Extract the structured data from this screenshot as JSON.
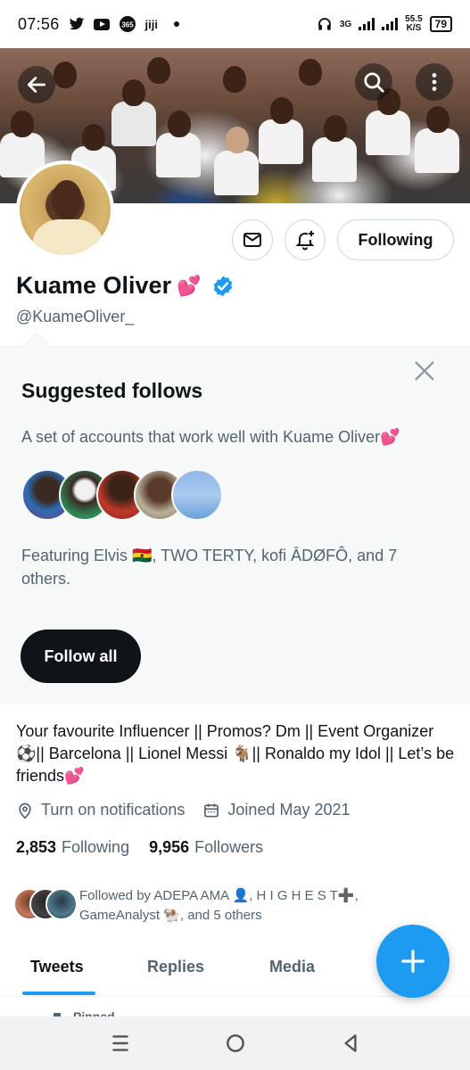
{
  "status_bar": {
    "time": "07:56",
    "network": "3G",
    "speed_top": "55.5",
    "speed_unit": "K/S",
    "battery": "79"
  },
  "banner": {
    "back_icon": "back-arrow-icon",
    "search_icon": "search-icon",
    "more_icon": "more-vertical-icon"
  },
  "profile": {
    "display_name": "Kuame Oliver",
    "name_emoji": "💕",
    "handle": "@KuameOliver_",
    "verified": true,
    "following_label": "Following",
    "bio": "Your favourite Influencer || Promos? Dm || Event Organizer ⚽|| Barcelona || Lionel Messi 🐐|| Ronaldo my Idol || Let’s be friends💕",
    "location_label": "Turn on notifications",
    "joined_label": "Joined May 2021",
    "following_count": "2,853",
    "following_word": "Following",
    "followers_count": "9,956",
    "followers_word": "Followers",
    "followed_by": "Followed by ADEPA AMA 👤, H I G H E S T➕, GameAnalyst 🐏, and 5 others"
  },
  "suggested": {
    "title": "Suggested follows",
    "description": "A set of accounts that work well with Kuame Oliver💕",
    "featuring": "Featuring Elvis 🇬🇭, TWO TERTY, kofi ĀDØFÔ, and 7 others.",
    "follow_all_label": "Follow all"
  },
  "tabs": [
    {
      "label": "Tweets",
      "active": true
    },
    {
      "label": "Replies",
      "active": false
    },
    {
      "label": "Media",
      "active": false
    }
  ],
  "pinned_label": "Pinned",
  "colors": {
    "accent": "#1d9bf0",
    "text_primary": "#0f1419",
    "text_secondary": "#536471",
    "heart": "#ff4f9a"
  }
}
